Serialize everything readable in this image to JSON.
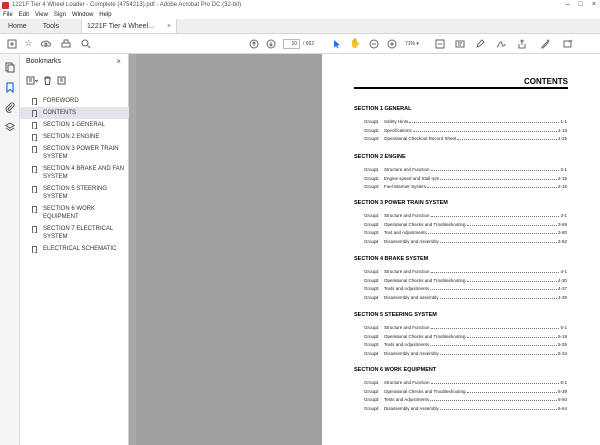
{
  "window": {
    "title": "1221F Tier 4 Wheel Loader - Complete (4754213).pdf - Adobe Acrobat Pro DC (32-bit)"
  },
  "menu": [
    "File",
    "Edit",
    "View",
    "Sign",
    "Window",
    "Help"
  ],
  "tabs": {
    "home": "Home",
    "tools": "Tools",
    "document": "1221F Tier 4 Wheel...",
    "close": "×"
  },
  "toolbar": {
    "page_current": "10",
    "page_total": "/ 662",
    "zoom": "71%"
  },
  "bookmarks": {
    "header": "Bookmarks",
    "close": "×",
    "items": [
      {
        "label": "FOREWORD"
      },
      {
        "label": "CONTENTS"
      },
      {
        "label": "SECTION 1 GENERAL"
      },
      {
        "label": "SECTION 2 ENGINE"
      },
      {
        "label": "SECTION 3 POWER TRAIN SYSTEM"
      },
      {
        "label": "SECTION 4 BRAKE AND FAN SYSTEM"
      },
      {
        "label": "SECTION 5 STEERING SYSTEM"
      },
      {
        "label": "SECTION 6 WORK EQUIPMENT"
      },
      {
        "label": "SECTION 7 ELECTRICAL SYSTEM"
      },
      {
        "label": "ELECTRICAL SCHEMATIC"
      }
    ]
  },
  "document": {
    "heading": "CONTENTS",
    "sections": [
      {
        "title": "SECTION 1 GENERAL",
        "groups": [
          {
            "group": "Group",
            "num": "1",
            "text": "Safety Hints",
            "page": "1-1"
          },
          {
            "group": "Group",
            "num": "2",
            "text": "Specifications",
            "page": "1-13"
          },
          {
            "group": "Group",
            "num": "3",
            "text": "Operational Checkout Record Sheet",
            "page": "1-25"
          }
        ]
      },
      {
        "title": "SECTION 2 ENGINE",
        "groups": [
          {
            "group": "Group",
            "num": "1",
            "text": "Structure and Function",
            "page": "2-1"
          },
          {
            "group": "Group",
            "num": "2",
            "text": "Engine speed and Stall rpm",
            "page": "2-15"
          },
          {
            "group": "Group",
            "num": "3",
            "text": "Fuel Warmer System",
            "page": "2-16"
          }
        ]
      },
      {
        "title": "SECTION 3 POWER TRAIN SYSTEM",
        "groups": [
          {
            "group": "Group",
            "num": "1",
            "text": "Structure and Function",
            "page": "3-1"
          },
          {
            "group": "Group",
            "num": "2",
            "text": "Operational Checks and Troubleshooting",
            "page": "3-69"
          },
          {
            "group": "Group",
            "num": "3",
            "text": "Test and Adjustments",
            "page": "3-80"
          },
          {
            "group": "Group",
            "num": "4",
            "text": "Disassembly and Assembly",
            "page": "3-82"
          }
        ]
      },
      {
        "title": "SECTION 4 BRAKE SYSTEM",
        "groups": [
          {
            "group": "Group",
            "num": "1",
            "text": "Structure and Function",
            "page": "4-1"
          },
          {
            "group": "Group",
            "num": "2",
            "text": "Operational Checks and Troubleshooting",
            "page": "4-30"
          },
          {
            "group": "Group",
            "num": "3",
            "text": "Tests and Adjustments",
            "page": "4-37"
          },
          {
            "group": "Group",
            "num": "4",
            "text": "Disassembly and assembly",
            "page": "4-39"
          }
        ]
      },
      {
        "title": "SECTION 5 STEERING SYSTEM",
        "groups": [
          {
            "group": "Group",
            "num": "1",
            "text": "Structure and Function",
            "page": "5-1"
          },
          {
            "group": "Group",
            "num": "2",
            "text": "Operational Checks and Troubleshooting",
            "page": "5-18"
          },
          {
            "group": "Group",
            "num": "3",
            "text": "Tests and Adjustments",
            "page": "5-26"
          },
          {
            "group": "Group",
            "num": "4",
            "text": "Disassembly and Assembly",
            "page": "5-34"
          }
        ]
      },
      {
        "title": "SECTION 6 WORK EQUIPMENT",
        "groups": [
          {
            "group": "Group",
            "num": "1",
            "text": "Structure and Function",
            "page": "6-1"
          },
          {
            "group": "Group",
            "num": "2",
            "text": "Operational Checks and Troubleshooting",
            "page": "6-39"
          },
          {
            "group": "Group",
            "num": "3",
            "text": "Tests and Adjustments",
            "page": "6-50"
          },
          {
            "group": "Group",
            "num": "4",
            "text": "Disassembly and Assembly",
            "page": "6-64"
          }
        ]
      }
    ]
  },
  "colors": {
    "accent": "#1a73e8",
    "doc_bg": "#a8a8a8"
  },
  "icons": {
    "rail": [
      "page-thumbnails-icon",
      "bookmarks-icon",
      "attachments-icon",
      "layers-icon"
    ],
    "toolbar": [
      "create-icon",
      "bookmark-add-icon",
      "upload-icon",
      "print-icon",
      "search-icon",
      "page-up-icon",
      "page-down-icon",
      "select-cursor-icon",
      "hand-icon",
      "zoom-out-icon",
      "zoom-in-icon",
      "fit-page-icon",
      "highlight-icon",
      "pen-icon",
      "sign-icon",
      "share-icon"
    ]
  }
}
